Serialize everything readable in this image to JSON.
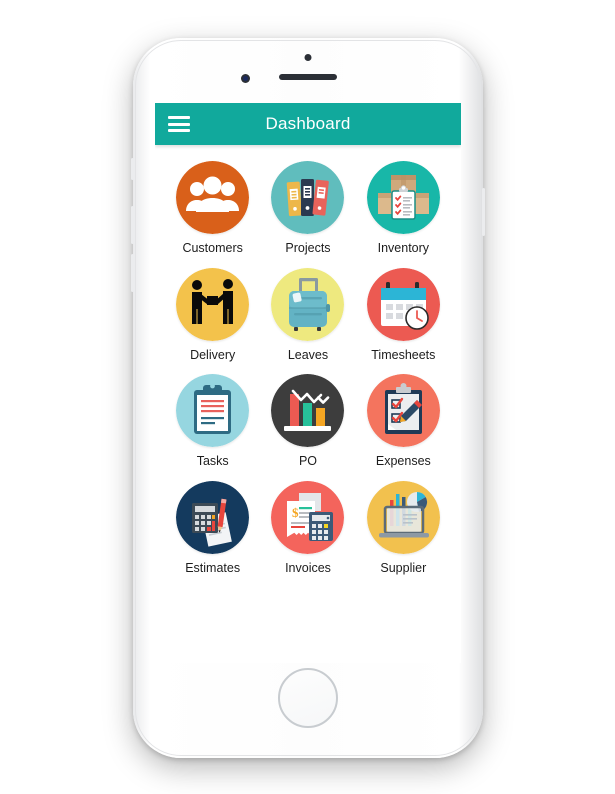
{
  "app": {
    "title": "Dashboard",
    "menu_icon": "hamburger-menu-icon",
    "header_color": "#11a99c",
    "label_color": "#1d1d1d"
  },
  "device": {
    "frame": "white-smartphone",
    "home_button": "home-button",
    "speaker": "earpiece-speaker",
    "camera": "front-camera",
    "sensor": "proximity-sensor"
  },
  "grid": {
    "columns": 3,
    "tiles": [
      {
        "label": "Customers",
        "icon": "customers-group-icon",
        "circle_color": "#d9601a",
        "name": "tile-customers"
      },
      {
        "label": "Projects",
        "icon": "binders-folders-icon",
        "circle_color": "#60bdbd",
        "name": "tile-projects"
      },
      {
        "label": "Inventory",
        "icon": "boxes-clipboard-icon",
        "circle_color": "#18b7a8",
        "name": "tile-inventory"
      },
      {
        "label": "Delivery",
        "icon": "package-handoff-icon",
        "circle_color": "#f3c24b",
        "name": "tile-delivery"
      },
      {
        "label": "Leaves",
        "icon": "suitcase-luggage-icon",
        "circle_color": "#eee97f",
        "name": "tile-leaves"
      },
      {
        "label": "Timesheets",
        "icon": "calendar-clock-icon",
        "circle_color": "#ec5a52",
        "name": "tile-timesheets"
      },
      {
        "label": "Tasks",
        "icon": "clipboard-checklist-icon",
        "circle_color": "#96d6e0",
        "name": "tile-tasks"
      },
      {
        "label": "PO",
        "icon": "bar-chart-decline-icon",
        "circle_color": "#3d3d3d",
        "name": "tile-po"
      },
      {
        "label": "Expenses",
        "icon": "checklist-pencil-icon",
        "circle_color": "#f4745e",
        "name": "tile-expenses"
      },
      {
        "label": "Estimates",
        "icon": "calculator-documents-icon",
        "circle_color": "#143a5e",
        "name": "tile-estimates"
      },
      {
        "label": "Invoices",
        "icon": "invoice-calculator-icon",
        "circle_color": "#f4645c",
        "name": "tile-invoices"
      },
      {
        "label": "Supplier",
        "icon": "laptop-analytics-icon",
        "circle_color": "#f2c14e",
        "name": "tile-supplier"
      }
    ]
  }
}
